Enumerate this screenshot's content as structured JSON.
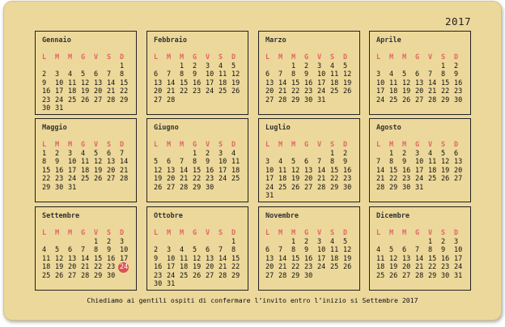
{
  "year": "2017",
  "weekday_headers": [
    "L",
    "M",
    "M",
    "G",
    "V",
    "S",
    "D"
  ],
  "highlight": {
    "month_index": 8,
    "day": "24",
    "color": "#e05050"
  },
  "months": [
    {
      "name": "Gennaio",
      "offset": 6,
      "days": 31
    },
    {
      "name": "Febbraio",
      "offset": 2,
      "days": 28
    },
    {
      "name": "Marzo",
      "offset": 2,
      "days": 31
    },
    {
      "name": "Aprile",
      "offset": 5,
      "days": 30
    },
    {
      "name": "Maggio",
      "offset": 0,
      "days": 31
    },
    {
      "name": "Giugno",
      "offset": 3,
      "days": 30
    },
    {
      "name": "Luglio",
      "offset": 5,
      "days": 31
    },
    {
      "name": "Agosto",
      "offset": 1,
      "days": 31
    },
    {
      "name": "Settembre",
      "offset": 4,
      "days": 30
    },
    {
      "name": "Ottobre",
      "offset": 6,
      "days": 31
    },
    {
      "name": "Novembre",
      "offset": 2,
      "days": 30
    },
    {
      "name": "Dicembre",
      "offset": 4,
      "days": 31
    }
  ],
  "footer": "Chiediamo ai gentili ospiti di confermare l’invito entro l’inizio si Settembre 2017",
  "colors": {
    "background": "#ecd89a",
    "weekday": "#e06666",
    "border": "#222222"
  }
}
